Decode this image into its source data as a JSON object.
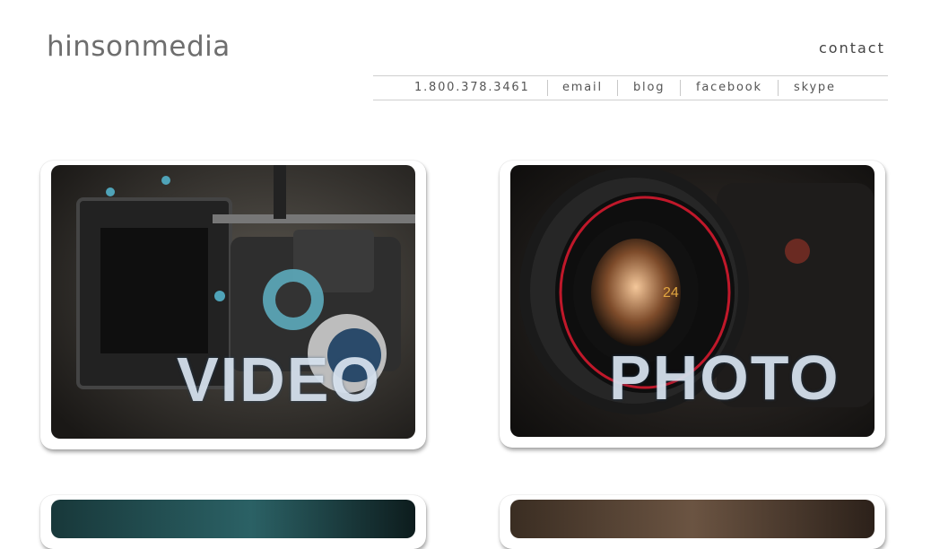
{
  "header": {
    "logo": "hinsonmedia",
    "contact_heading": "contact"
  },
  "contact_bar": {
    "phone": "1.800.378.3461",
    "email": "email",
    "blog": "blog",
    "facebook": "facebook",
    "skype": "skype"
  },
  "cards": [
    {
      "label": "VIDEO"
    },
    {
      "label": "PHOTO"
    }
  ],
  "lens": {
    "focal_length": "24"
  },
  "colors": {
    "logo": "#6e6e6e",
    "text": "#444444",
    "rule": "#cfcfcf",
    "lens_red": "#c0182a"
  }
}
